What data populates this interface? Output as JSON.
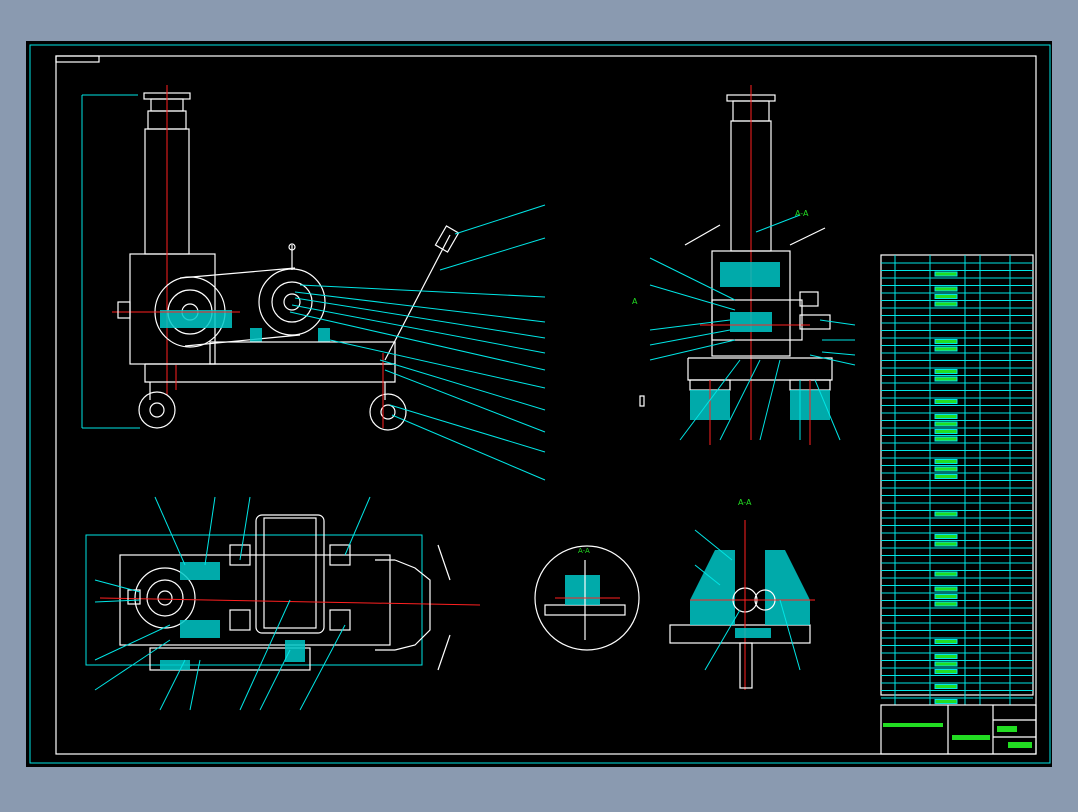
{
  "drawing": {
    "background": "#000000",
    "viewport_bg": "#8a9ab0",
    "colors": {
      "outline": "#ffffff",
      "leader": "#00e5e5",
      "centerline": "#ff2020",
      "text": "#22dd22"
    },
    "section_labels": {
      "top_right": "A-A",
      "bottom_right": "A-A",
      "detail_circle": "A-A",
      "side_marker": "A"
    }
  }
}
